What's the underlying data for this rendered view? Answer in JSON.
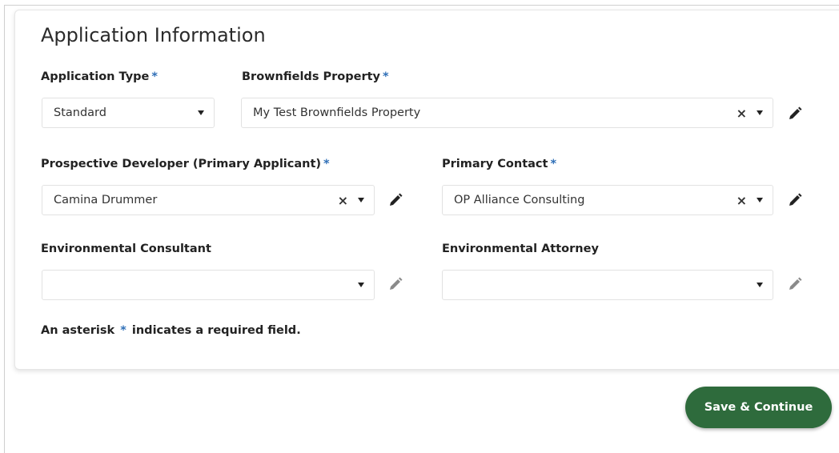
{
  "section": {
    "title": "Application Information",
    "required_marker": "*"
  },
  "fields": {
    "application_type": {
      "label": "Application Type",
      "value": "Standard"
    },
    "brownfields_property": {
      "label": "Brownfields Property",
      "value": "My Test Brownfields Property"
    },
    "prospective_developer": {
      "label": "Prospective Developer (Primary Applicant)",
      "value": "Camina Drummer"
    },
    "primary_contact": {
      "label": "Primary Contact",
      "value": "OP Alliance Consulting"
    },
    "environmental_consultant": {
      "label": "Environmental Consultant",
      "value": ""
    },
    "environmental_attorney": {
      "label": "Environmental Attorney",
      "value": ""
    }
  },
  "icons": {
    "clear": "×",
    "caret": "chevron-down-icon",
    "edit": "pencil-icon"
  },
  "note": {
    "prefix": "An asterisk",
    "marker": "*",
    "suffix": "indicates a required field."
  },
  "actions": {
    "save_label": "Save & Continue",
    "save_color": "#2e6b3c"
  },
  "colors": {
    "required_marker": "#2f6fb7",
    "edit_active": "#222222",
    "edit_disabled": "#8a8a8a"
  }
}
